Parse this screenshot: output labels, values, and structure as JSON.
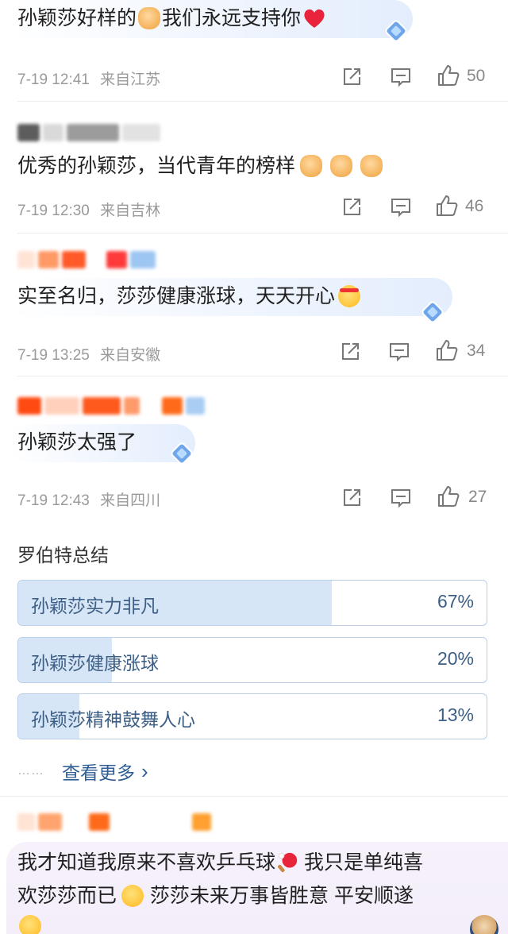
{
  "comments": [
    {
      "text_a": "孙颖莎好样的",
      "text_b": "我们永远支持你",
      "time": "7-19 12:41",
      "location": "来自江苏",
      "likes": "50"
    },
    {
      "text_a": "优秀的孙颖莎，当代青年的榜样",
      "time": "7-19 12:30",
      "location": "来自吉林",
      "likes": "46"
    },
    {
      "text_a": "实至名归，莎莎健康涨球，天天开心",
      "time": "7-19 13:25",
      "location": "来自安徽",
      "likes": "34"
    },
    {
      "text_a": "孙颖莎太强了",
      "time": "7-19 12:43",
      "location": "来自四川",
      "likes": "27"
    }
  ],
  "poll": {
    "title": "罗伯特总结",
    "options": [
      {
        "label": "孙颖莎实力非凡",
        "percent": "67%",
        "fraction": 0.67
      },
      {
        "label": "孙颖莎健康涨球",
        "percent": "20%",
        "fraction": 0.2
      },
      {
        "label": "孙颖莎精神鼓舞人心",
        "percent": "13%",
        "fraction": 0.13
      }
    ],
    "more_label": "查看更多",
    "more_dots": "……",
    "more_chevron": "›"
  },
  "last_comment": {
    "line1_a": "我才知道我原来不喜欢乒乓球",
    "line1_b": "我只是单纯喜",
    "line2_a": "欢莎莎而已",
    "line2_b": "莎莎未来万事皆胜意 平安顺遂"
  },
  "icons": {
    "share": "share-icon",
    "comment": "comment-icon",
    "like": "thumbs-up-icon"
  },
  "colors": {
    "accent_blue": "#2f5e95",
    "poll_fill": "#d7e6f6",
    "poll_border": "#b9cfe8"
  }
}
